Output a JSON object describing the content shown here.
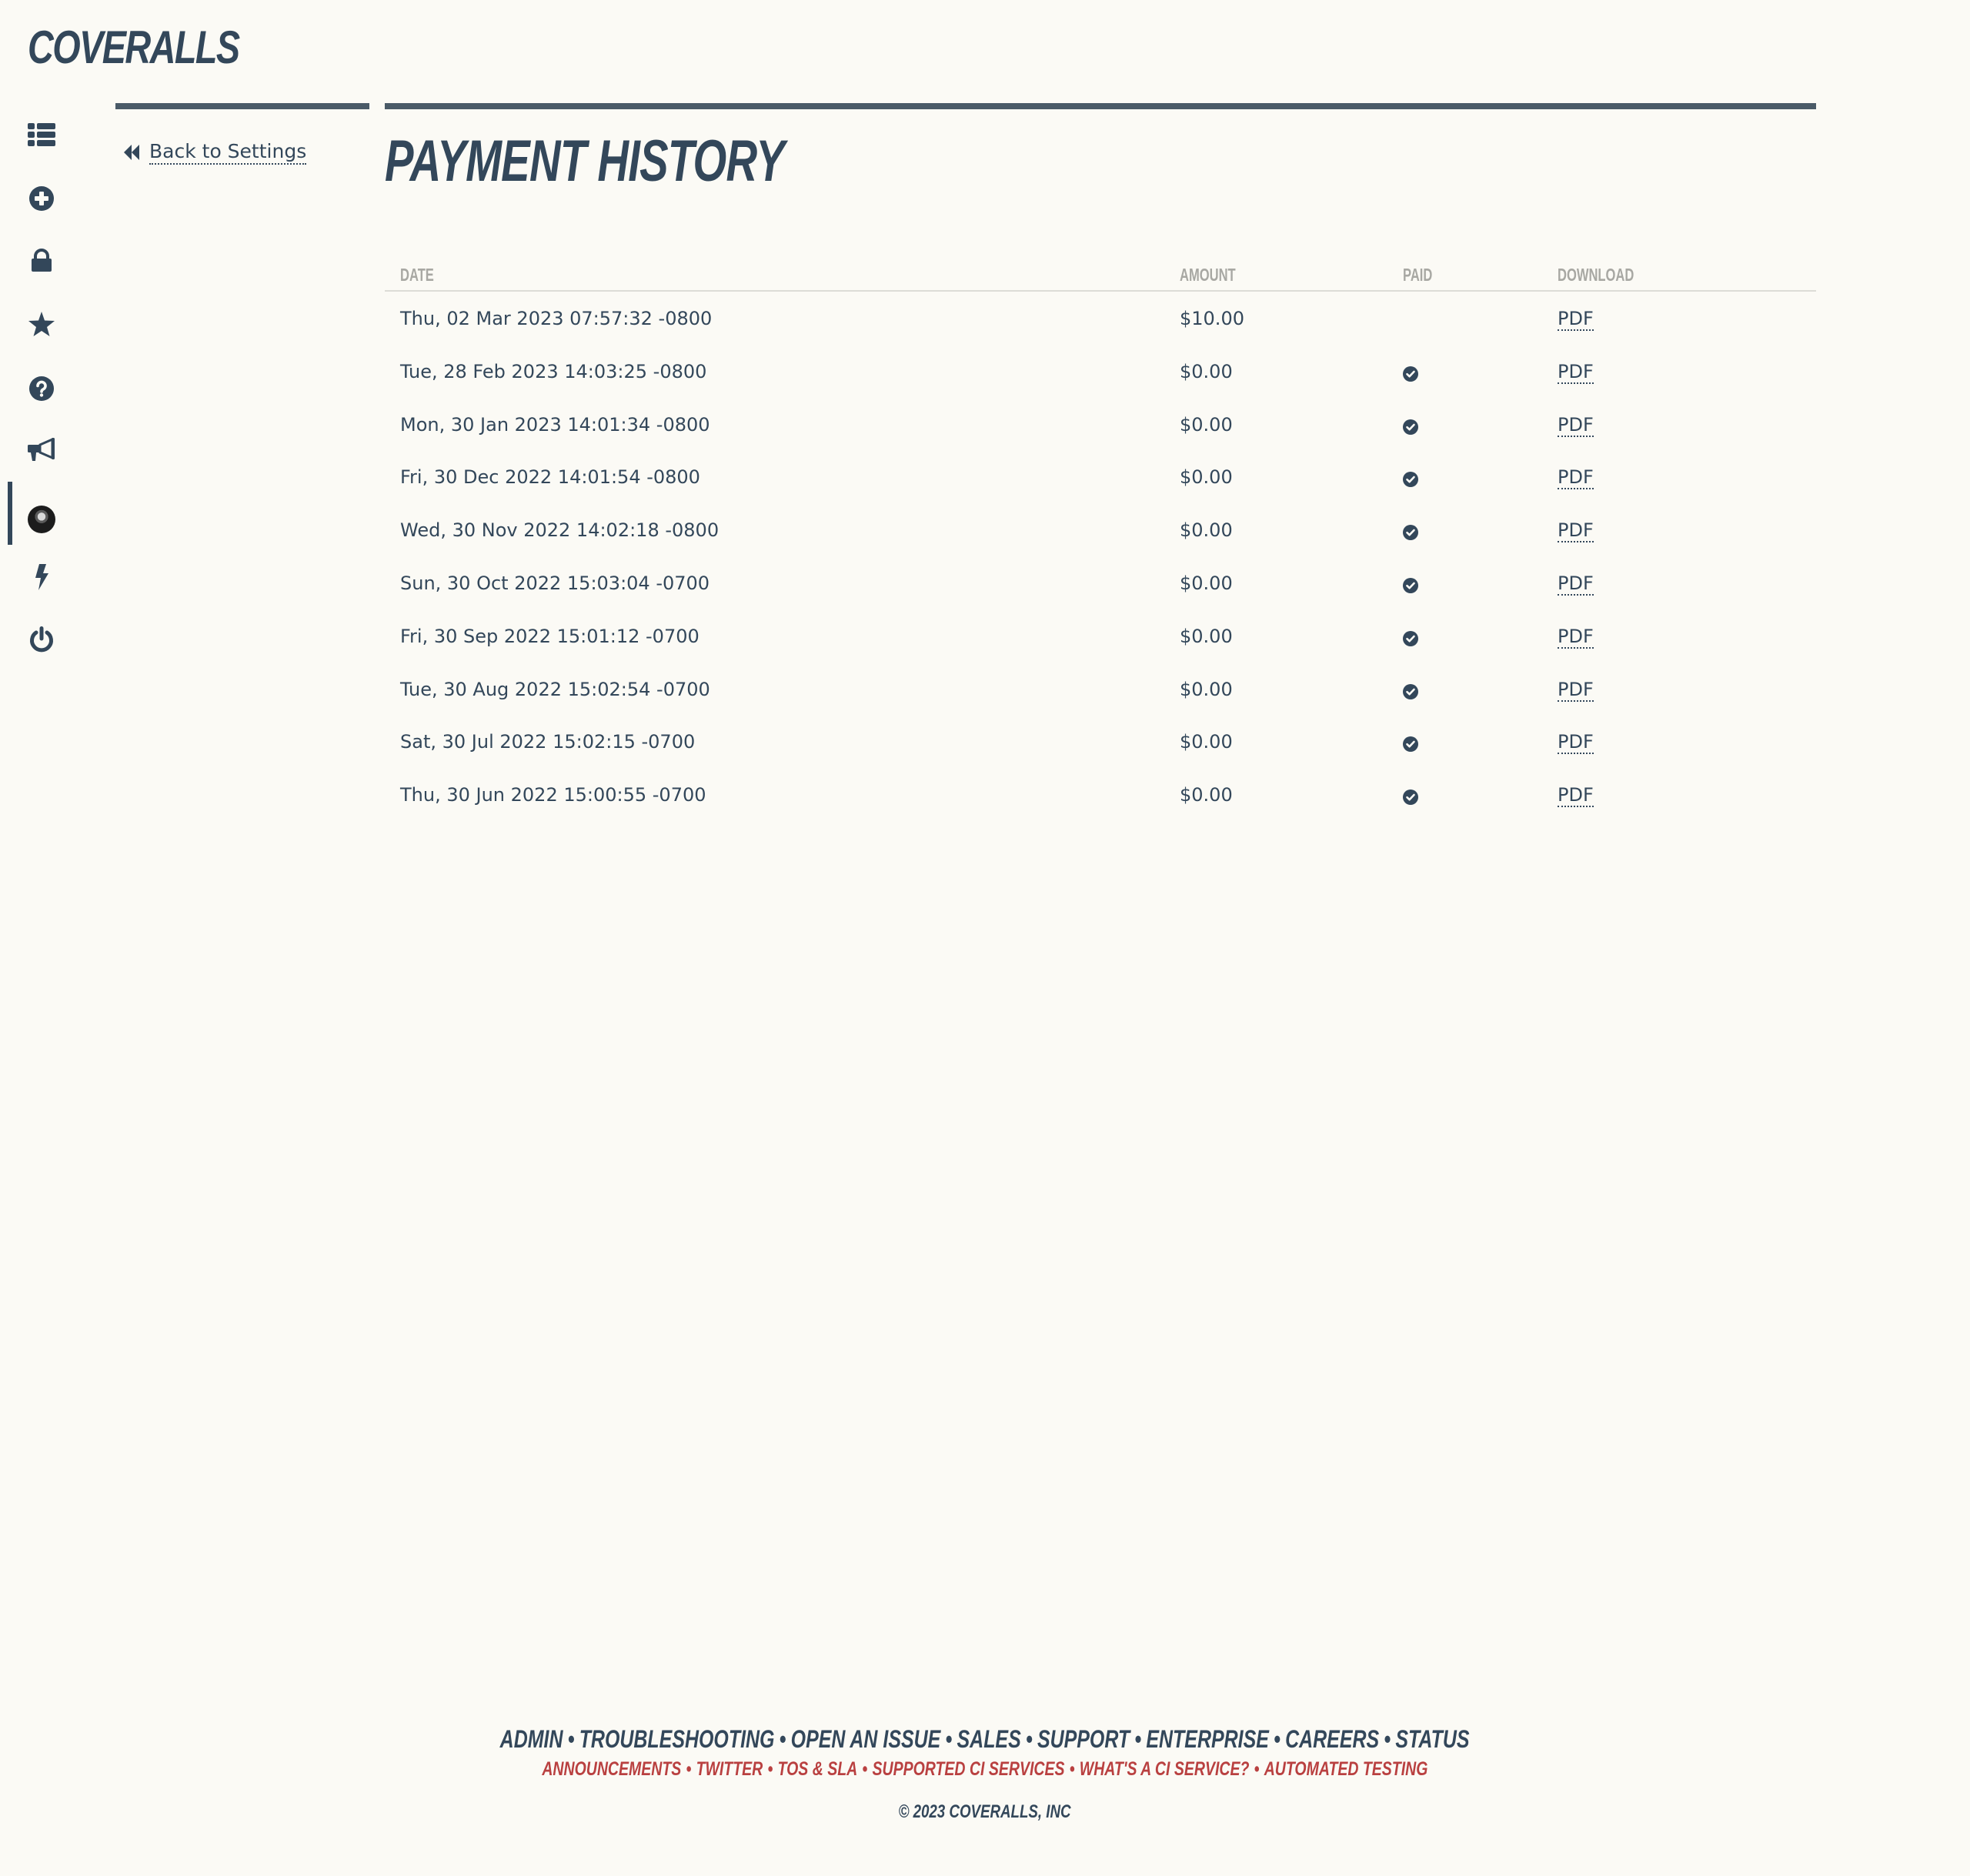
{
  "brand": {
    "name": "COVERALLS"
  },
  "sidebar": {
    "items": [
      {
        "name": "repos",
        "icon": "list-icon"
      },
      {
        "name": "add-repo",
        "icon": "plus-circle-icon"
      },
      {
        "name": "private",
        "icon": "lock-icon"
      },
      {
        "name": "pro",
        "icon": "star-icon"
      },
      {
        "name": "help",
        "icon": "question-circle-icon"
      },
      {
        "name": "announcements",
        "icon": "megaphone-icon"
      },
      {
        "name": "account",
        "icon": "avatar",
        "active": true
      },
      {
        "name": "api",
        "icon": "bolt-icon"
      },
      {
        "name": "sign-out",
        "icon": "power-icon"
      }
    ]
  },
  "back_link": {
    "label": "Back to Settings",
    "icon": "backward-icon"
  },
  "page": {
    "title": "PAYMENT HISTORY"
  },
  "table": {
    "headers": {
      "date": "DATE",
      "amount": "AMOUNT",
      "paid": "PAID",
      "download": "DOWNLOAD"
    },
    "rows": [
      {
        "date": "Thu, 02 Mar 2023 07:57:32 -0800",
        "amount": "$10.00",
        "paid": false,
        "download": "PDF"
      },
      {
        "date": "Tue, 28 Feb 2023 14:03:25 -0800",
        "amount": "$0.00",
        "paid": true,
        "download": "PDF"
      },
      {
        "date": "Mon, 30 Jan 2023 14:01:34 -0800",
        "amount": "$0.00",
        "paid": true,
        "download": "PDF"
      },
      {
        "date": "Fri, 30 Dec 2022 14:01:54 -0800",
        "amount": "$0.00",
        "paid": true,
        "download": "PDF"
      },
      {
        "date": "Wed, 30 Nov 2022 14:02:18 -0800",
        "amount": "$0.00",
        "paid": true,
        "download": "PDF"
      },
      {
        "date": "Sun, 30 Oct 2022 15:03:04 -0700",
        "amount": "$0.00",
        "paid": true,
        "download": "PDF"
      },
      {
        "date": "Fri, 30 Sep 2022 15:01:12 -0700",
        "amount": "$0.00",
        "paid": true,
        "download": "PDF"
      },
      {
        "date": "Tue, 30 Aug 2022 15:02:54 -0700",
        "amount": "$0.00",
        "paid": true,
        "download": "PDF"
      },
      {
        "date": "Sat, 30 Jul 2022 15:02:15 -0700",
        "amount": "$0.00",
        "paid": true,
        "download": "PDF"
      },
      {
        "date": "Thu, 30 Jun 2022 15:00:55 -0700",
        "amount": "$0.00",
        "paid": true,
        "download": "PDF"
      }
    ]
  },
  "footer": {
    "primary_links": [
      "ADMIN",
      "TROUBLESHOOTING",
      "OPEN AN ISSUE",
      "SALES",
      "SUPPORT",
      "ENTERPRISE",
      "CAREERS",
      "STATUS"
    ],
    "secondary_links": [
      "ANNOUNCEMENTS",
      "TWITTER",
      "TOS & SLA",
      "SUPPORTED CI SERVICES",
      "WHAT'S A CI SERVICE?",
      "AUTOMATED TESTING"
    ],
    "separator": "•",
    "copyright": "© 2023 COVERALLS, INC"
  },
  "colors": {
    "primary": "#33475a",
    "accent_red": "#b94040",
    "header_text": "#a8a8a3",
    "background": "#fbfaf5"
  }
}
